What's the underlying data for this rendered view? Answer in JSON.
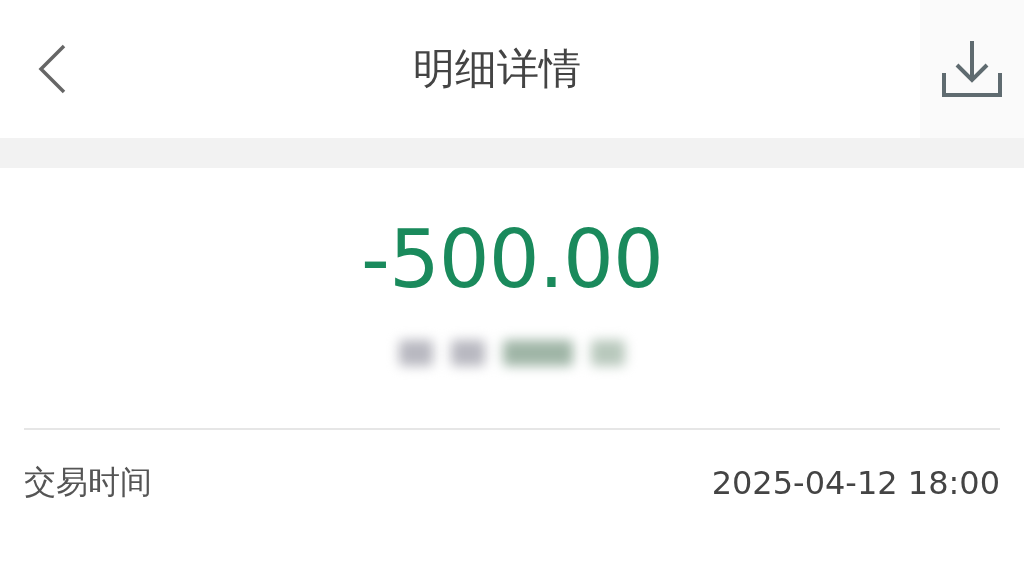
{
  "header": {
    "title": "明细详情"
  },
  "amount": "-500.00",
  "details": [
    {
      "label": "交易时间",
      "value": "2025-04-12 18:00"
    }
  ]
}
